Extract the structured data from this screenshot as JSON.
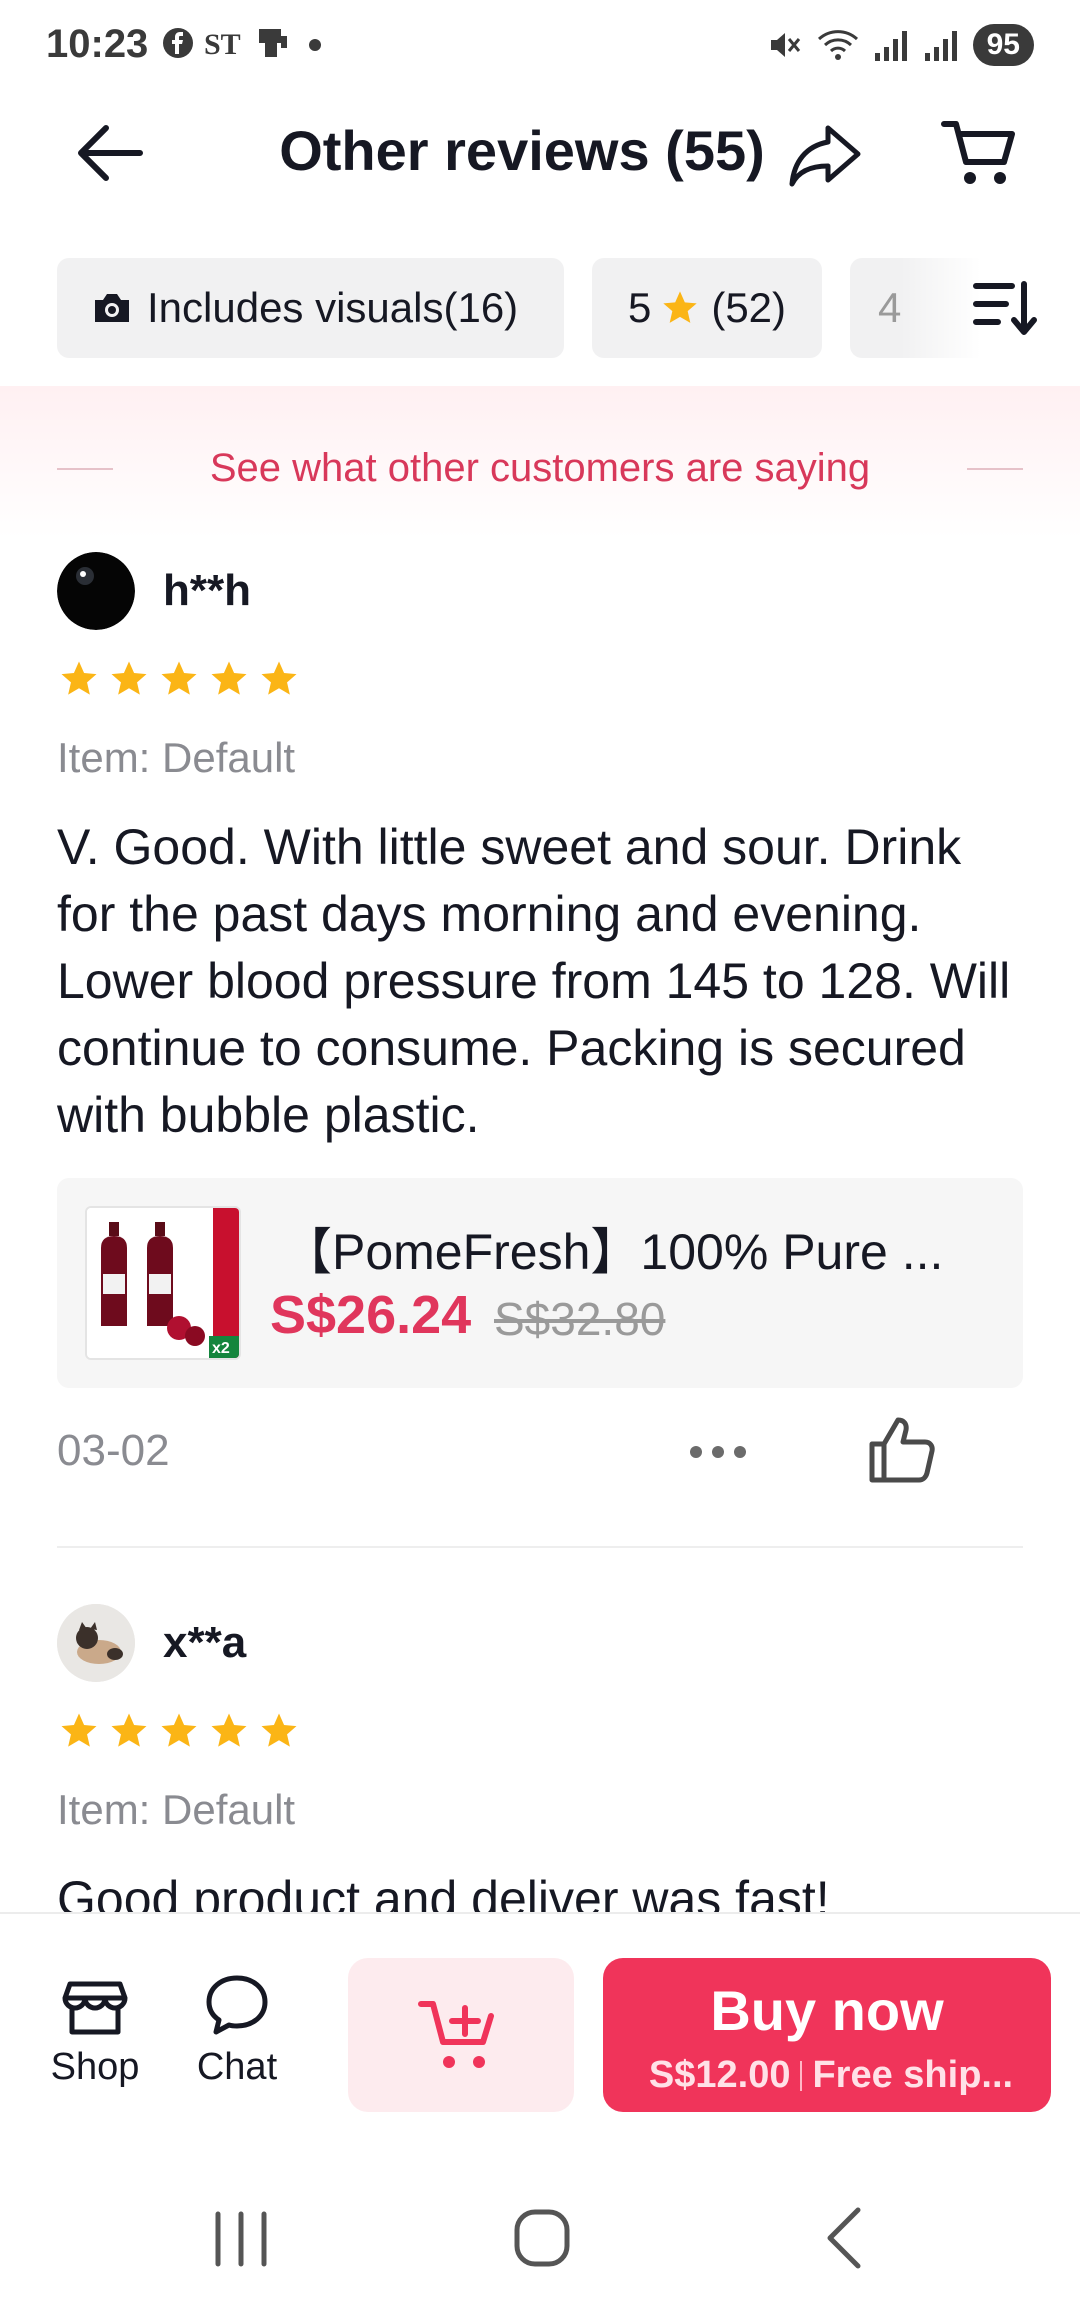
{
  "status_bar": {
    "time": "10:23",
    "left_icons": [
      "facebook-icon",
      "st-icon",
      "phone-icon",
      "dot"
    ],
    "right_icons": [
      "mute-icon",
      "wifi-icon",
      "signal-icon",
      "signal-icon"
    ],
    "battery": "95"
  },
  "header": {
    "title": "Other reviews (55)",
    "icons": [
      "back-arrow-icon",
      "share-icon",
      "cart-icon"
    ]
  },
  "filters": {
    "chips": [
      {
        "icon": "camera-icon",
        "label": "Includes visuals(16)"
      },
      {
        "rating": "5",
        "count": "(52)"
      },
      {
        "rating": "4"
      }
    ],
    "sort_icon": "sort-icon"
  },
  "banner": {
    "text": "See what other customers are saying"
  },
  "reviews": [
    {
      "username": "h**h",
      "stars": 5,
      "item": "Item: Default",
      "text": "V. Good. With little sweet and sour. Drink for the past days morning and evening. Lower blood pressure from 145 to 128. Will continue to consume. Packing is secured with bubble plastic.",
      "product": {
        "title": "【PomeFresh】100% Pure ...",
        "price": "S$26.24",
        "old_price": "S$32.80",
        "badge": "x2"
      },
      "date": "03-02"
    },
    {
      "username": "x**a",
      "stars": 5,
      "item": "Item: Default",
      "text": "Good product and deliver was fast!"
    }
  ],
  "bottom_bar": {
    "shop_label": "Shop",
    "chat_label": "Chat",
    "buy_now_label": "Buy now",
    "buy_now_price": "S$12.00",
    "buy_now_shipping": "Free ship..."
  },
  "colors": {
    "accent": "#f0345a",
    "price": "#e0365c",
    "star": "#fbb516",
    "banner_text": "#d8385a"
  }
}
